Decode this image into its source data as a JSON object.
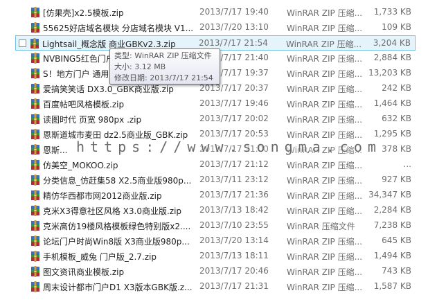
{
  "files": [
    {
      "name": "[仿果壳]x2.5模板.zip",
      "date": "2013/7/17 19:40",
      "type": "WinRAR ZIP 压缩...",
      "size": "1,733 KB"
    },
    {
      "name": "55625好店域名模块 分店域名模块 V1...",
      "date": "2013/7/20 13:10",
      "type": "WinRAR ZIP 压缩...",
      "size": "109 KB"
    },
    {
      "name": "Lightsail_概念版 商业GBKv2.3.zip",
      "date": "2013/7/17 21:54",
      "type": "WinRAR ZIP 压缩...",
      "size": "3,204 KB"
    },
    {
      "name": "NVBING5红色门户...",
      "date": "2013/7/17 21:40",
      "type": "WinRAR ZIP 压缩...",
      "size": "2,884 KB"
    },
    {
      "name": "S！地方门户 通用...",
      "date": "2013/7/17 19:37",
      "type": "WinRAR ZIP 压缩...",
      "size": "13,203 KB"
    },
    {
      "name": "爱搞笑笑话 DX3.0_GBK商业版.zip",
      "date": "2013/7/17 20:37",
      "type": "WinRAR ZIP 压缩...",
      "size": "242 KB"
    },
    {
      "name": "百度帖吧风格模板.zip",
      "date": "2013/7/17 19:46",
      "type": "WinRAR ZIP 压缩...",
      "size": "1,464 KB"
    },
    {
      "name": "读图时代 页宽 980px .zip",
      "date": "2013/7/17 20:02",
      "type": "WinRAR ZIP 压缩...",
      "size": "632 KB"
    },
    {
      "name": "恩斯道城市麦田 dz2.5商业版_GBK.zip",
      "date": "2013/7/17 20:53",
      "type": "WinRAR ZIP 压缩...",
      "size": "1,295 KB"
    },
    {
      "name": "恩斯...",
      "date": "2013/7/17 21:00",
      "type": "WinRAR ZIP 压缩...",
      "size": "378 KB"
    },
    {
      "name": "仿美空_MOKOO.zip",
      "date": "2013/7/17 21:12",
      "type": "WinRAR ZIP 压缩...",
      "size": "..."
    },
    {
      "name": "分类信息_仿赶集58 X2.5商业版980p...",
      "date": "2013/7/11 23:12",
      "type": "WinRAR ZIP 压缩...",
      "size": "927 KB"
    },
    {
      "name": "精仿华西都市网2012商业版.zip",
      "date": "2013/7/17 21:36",
      "type": "WinRAR ZIP 压缩...",
      "size": "34,347 KB"
    },
    {
      "name": "克米X3得意社区风格 X3.0商业版.zip",
      "date": "2013/7/13 18:42",
      "type": "WinRAR ZIP 压缩...",
      "size": "2,284 KB"
    },
    {
      "name": "克米高仿19楼风格模板绿色特别版x2....",
      "date": "2013/7/10 23:55",
      "type": "WinRAR 压缩文件",
      "size": "7,238 KB"
    },
    {
      "name": "论坛门户时尚Win8版 X3商业版980p...",
      "date": "2013/7/20 13:14",
      "type": "WinRAR ZIP 压缩...",
      "size": "645 KB"
    },
    {
      "name": "手机模板_威兔 门户版_2.7.zip",
      "date": "2013/7/13 18:11",
      "type": "WinRAR ZIP 压缩...",
      "size": "1,494 KB"
    },
    {
      "name": "图文资讯商业模板.zip",
      "date": "2013/7/17 20:46",
      "type": "WinRAR ZIP 压缩...",
      "size": "743 KB"
    },
    {
      "name": "周末设计都市门户D1 X3版本GBK版.z...",
      "date": "2013/7/17 21:31",
      "type": "WinRAR ZIP 压缩...",
      "size": "1,587 KB"
    }
  ],
  "hover_index": 2,
  "tooltip": {
    "type_line": "类型: WinRAR ZIP 压缩文件",
    "size_line": "大小: 3.12 MB",
    "date_line": "修改日期: 2013/7/17 21:54"
  },
  "watermark": "https://www.songma.com",
  "icon": "winrar-archive-icon"
}
